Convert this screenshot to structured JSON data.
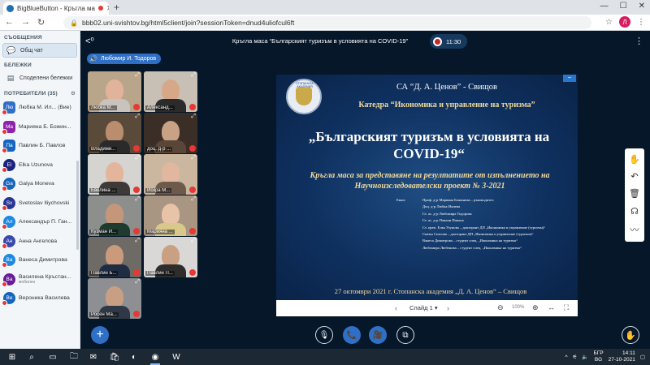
{
  "browser": {
    "tab_title": "BigBlueButton - Кръгла ма",
    "url": "bbb02.uni-svishtov.bg/html5client/join?sessionToken=dnud4uliofcul6ft",
    "profile_letter": "Л"
  },
  "sidebar": {
    "messages_header": "СЪОБЩЕНИЯ",
    "public_chat": "Общ чат",
    "notes_header": "БЕЛЕЖКИ",
    "shared_notes": "Споделени бележки",
    "users_header": "ПОТРЕБИТЕЛИ (35)",
    "users": [
      {
        "initials": "Лю",
        "name": "Любка М. Ил... (Вие)",
        "sub": "",
        "color": "#2f6fc6"
      },
      {
        "initials": "Ма",
        "name": "Марияна Б. Божин...",
        "sub": "",
        "color": "#8e24aa"
      },
      {
        "initials": "Па",
        "name": "Павлин Б. Павлов",
        "sub": "",
        "color": "#1565c0"
      },
      {
        "initials": "El",
        "name": "Elka Uzunova",
        "sub": "",
        "color": "#1a237e"
      },
      {
        "initials": "Ga",
        "name": "Galya Moneva",
        "sub": "",
        "color": "#1565c0"
      },
      {
        "initials": "Sv",
        "name": "Svetoslav Iliychovski",
        "sub": "",
        "color": "#283593"
      },
      {
        "initials": "Ал",
        "name": "Александър П. Ган...",
        "sub": "",
        "color": "#1e88e5"
      },
      {
        "initials": "Ан",
        "name": "Анна Ангелова",
        "sub": "",
        "color": "#3949ab"
      },
      {
        "initials": "Ва",
        "name": "Ванеса Димитрова",
        "sub": "",
        "color": "#1e88e5"
      },
      {
        "initials": "Ва",
        "name": "Василена Кръстан...",
        "sub": "мобилно",
        "color": "#6a1b9a"
      },
      {
        "initials": "Ве",
        "name": "Вероника Василева",
        "sub": "",
        "color": "#1565c0"
      }
    ]
  },
  "meeting": {
    "title": "Кръгла маса “Българският туризъм в условията на COVID-19”",
    "timer": "11:30",
    "speaker": "Любомир И. Тодоров"
  },
  "videos": [
    {
      "name": "Любка М...",
      "bg": "#b9a58a",
      "skin": "#e0b39a",
      "cloth": "#c9c3bd"
    },
    {
      "name": "Александ...",
      "bg": "#c8bfb5",
      "skin": "#d7a888",
      "cloth": "#2b2b2b"
    },
    {
      "name": "Владими...",
      "bg": "#5a4a3a",
      "skin": "#b98d6e",
      "cloth": "#2a2a2a"
    },
    {
      "name": "доц. д-р ...",
      "bg": "#3a2e27",
      "skin": "#c9a184",
      "cloth": "#5a4638"
    },
    {
      "name": "Евелина ...",
      "bg": "#d6d4d0",
      "skin": "#e3b59c",
      "cloth": "#3e3a3a"
    },
    {
      "name": "Искра М...",
      "bg": "#cbb79f",
      "skin": "#e2b79f",
      "cloth": "#6d5a4a"
    },
    {
      "name": "Кузман И...",
      "bg": "#8c8f8c",
      "skin": "#c4977b",
      "cloth": "#1f3a2f"
    },
    {
      "name": "Марияна ...",
      "bg": "#a89582",
      "skin": "#e7c3a8",
      "cloth": "#d9c88c"
    },
    {
      "name": "Павлин Б...",
      "bg": "#6e6a66",
      "skin": "#c99a7c",
      "cloth": "#1e2d42"
    },
    {
      "name": "Павлин П...",
      "bg": "#d9d8d6",
      "skin": "#caa083",
      "cloth": "#2d2d2d"
    },
    {
      "name": "Росен Ма...",
      "bg": "#8d8f92",
      "skin": "#c99f84",
      "cloth": "#2f3945"
    }
  ],
  "slide": {
    "logo_text": "СТОПАНСКА АКАДЕМИЯ",
    "org": "СА “Д. А. Ценов” - Свищов",
    "department": "Катедра “Икономика и управление на туризма”",
    "title": "„Българският туризъм в условията на COVID-19“",
    "subtitle": "Кръгла маса за представяне на резултатите от изпълнението на Научноизследователски проект № 3-2021",
    "authors_label": "Екип:",
    "authors": [
      "Проф. д-р Марияна Божинова – ръководител",
      "Доц. д-р Любка Илиева",
      "Гл. ас. д-р Любомира Тодорова",
      "Гл. ас. д-р Павлин Павлов",
      "Ст. преп. Елка Узунова – докторант ДП „Икономика и управление (туризъм)“",
      "Снежа Спасова – докторант ДП „Икономика и управление (туризъм)“",
      "Ванеса Димитрова – студент спец. „Икономика на туризма“",
      "Любомира Любенова – студент спец. „Икономика на туризма“"
    ],
    "footer": "27 октомври 2021 г. Стопанска академия „Д. А. Ценов“ – Свищов"
  },
  "presentation_bar": {
    "slide_label": "Слайд 1",
    "zoom": "100%"
  },
  "taskbar": {
    "lang_top": "БГР",
    "lang_bottom": "BG",
    "time": "14:11",
    "date": "27-10-2021"
  }
}
